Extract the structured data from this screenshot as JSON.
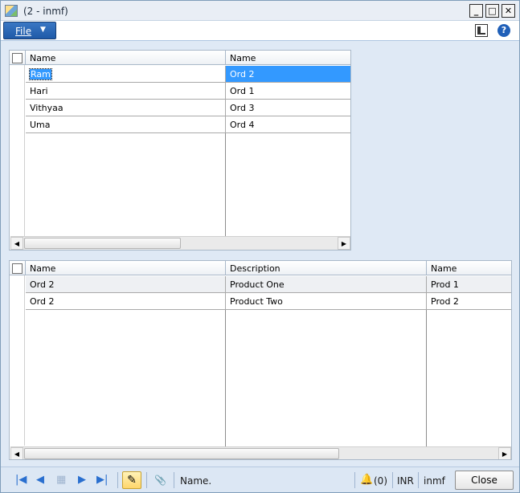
{
  "window": {
    "title": "(2 - inmf)",
    "min_glyph": "_",
    "max_glyph": "□",
    "close_glyph": "✕"
  },
  "menu": {
    "file_label": "File",
    "file_arrow": "▼",
    "help_glyph": "?"
  },
  "grid_top": {
    "headers": [
      "Name",
      "Name"
    ],
    "rows": [
      {
        "name": "Ram",
        "order": "Ord 2",
        "selected": true
      },
      {
        "name": "Hari",
        "order": "Ord 1"
      },
      {
        "name": "Vithyaa",
        "order": "Ord 3"
      },
      {
        "name": "Uma",
        "order": "Ord 4"
      }
    ]
  },
  "grid_bottom": {
    "headers": [
      "Name",
      "Description",
      "Name"
    ],
    "rows": [
      {
        "order": "Ord 2",
        "description": "Product One",
        "product": "Prod 1"
      },
      {
        "order": "Ord 2",
        "description": "Product Two",
        "product": "Prod 2"
      }
    ]
  },
  "scroll": {
    "left": "◀",
    "right": "▶"
  },
  "statusbar": {
    "first": "|◀",
    "prev": "◀",
    "grid": "▦",
    "next": "▶",
    "last": "▶|",
    "edit_glyph": "✎",
    "attach_glyph": "📎",
    "field_text": "Name.",
    "bell_glyph": "🔔",
    "notification_count": "(0)",
    "currency": "INR",
    "company": "inmf",
    "close_label": "Close"
  }
}
